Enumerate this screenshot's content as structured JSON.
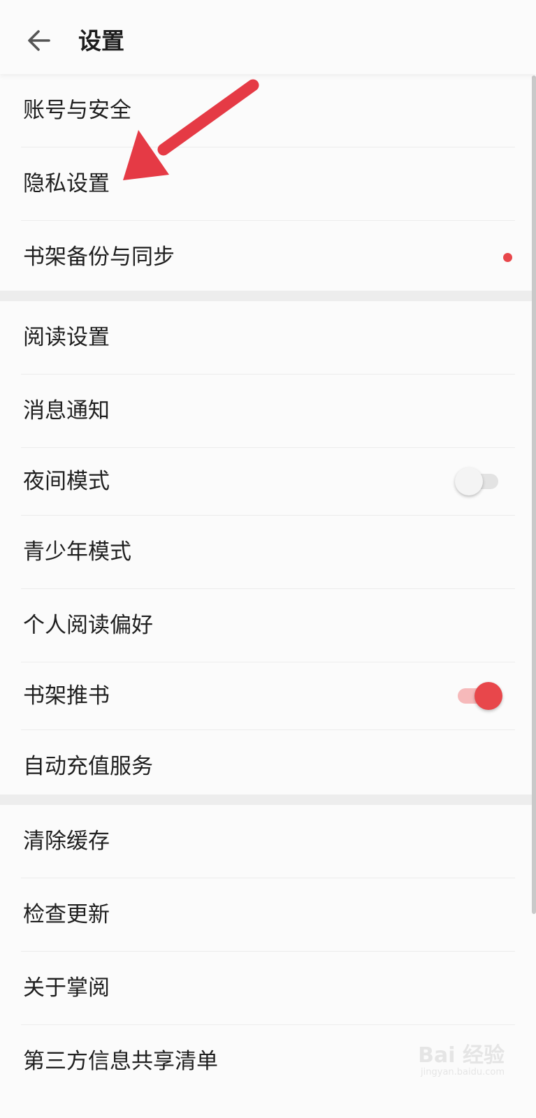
{
  "header": {
    "title": "设置",
    "back_icon": "arrow-left-icon"
  },
  "sections": [
    {
      "items": [
        {
          "label": "账号与安全"
        },
        {
          "label": "隐私设置"
        },
        {
          "label": "书架备份与同步"
        }
      ]
    },
    {
      "items": [
        {
          "label": "阅读设置"
        },
        {
          "label": "消息通知"
        },
        {
          "label": "夜间模式"
        },
        {
          "label": "青少年模式"
        },
        {
          "label": "个人阅读偏好"
        },
        {
          "label": "书架推书"
        },
        {
          "label": "自动充值服务"
        }
      ]
    },
    {
      "items": [
        {
          "label": "清除缓存"
        },
        {
          "label": "检查更新"
        },
        {
          "label": "关于掌阅"
        },
        {
          "label": "第三方信息共享清单"
        }
      ]
    }
  ],
  "toggles": {
    "night_mode": false,
    "shelf_recommend": true
  },
  "colors": {
    "accent": "#e8474b",
    "divider": "#ececec",
    "section_gap": "#ededed",
    "annotation_arrow": "#e53a45"
  },
  "watermark": {
    "main": "Bai 经验",
    "sub": "jingyan.baidu.com"
  }
}
